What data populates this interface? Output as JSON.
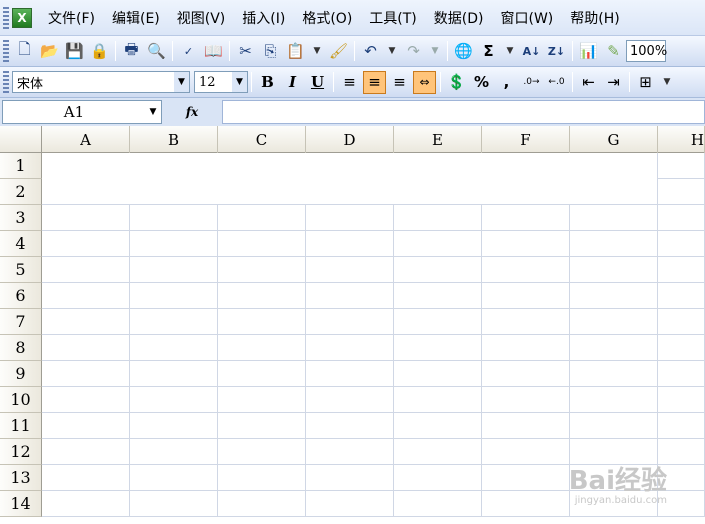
{
  "menubar": {
    "items": [
      "文件(F)",
      "编辑(E)",
      "视图(V)",
      "插入(I)",
      "格式(O)",
      "工具(T)",
      "数据(D)",
      "窗口(W)",
      "帮助(H)"
    ]
  },
  "toolbar": {
    "zoom": "100%",
    "icons": [
      "new-icon",
      "open-icon",
      "save-icon",
      "permission-icon",
      "print-icon",
      "print-preview-icon",
      "spelling-icon",
      "research-icon",
      "cut-icon",
      "copy-icon",
      "paste-icon",
      "format-painter-icon",
      "undo-icon",
      "redo-icon",
      "hyperlink-icon",
      "autosum-icon",
      "sort-asc-icon",
      "sort-desc-icon",
      "chart-icon",
      "drawing-icon"
    ],
    "autosum_glyph": "Σ"
  },
  "format_toolbar": {
    "font": "宋体",
    "size": "12",
    "bold": "B",
    "italic": "I",
    "underline": "U",
    "percent": "%",
    "comma": ","
  },
  "formula_bar": {
    "name_box": "A1",
    "fx": "fx",
    "formula": ""
  },
  "sheet": {
    "columns": [
      "A",
      "B",
      "C",
      "D",
      "E",
      "F",
      "G",
      "H"
    ],
    "rows": [
      "1",
      "2",
      "3",
      "4",
      "5",
      "6",
      "7",
      "8",
      "9",
      "10",
      "11",
      "12",
      "13",
      "14"
    ]
  },
  "watermark": {
    "text": "Bai经验",
    "url": "jingyan.baidu.com"
  }
}
